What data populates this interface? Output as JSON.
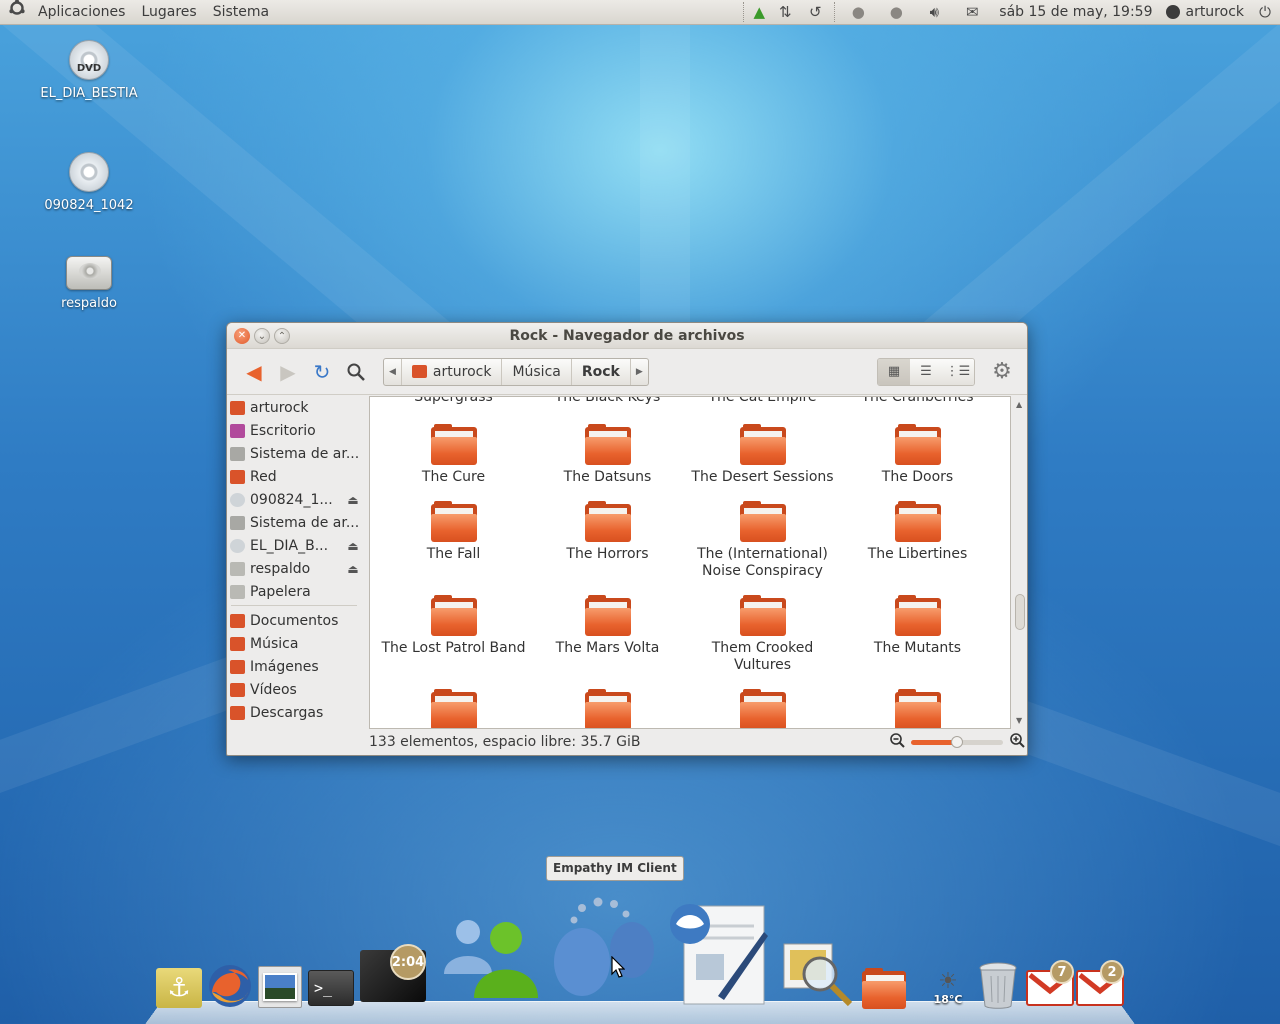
{
  "top_panel": {
    "menus": [
      "Aplicaciones",
      "Lugares",
      "Sistema"
    ],
    "clock": "sáb 15 de may, 19:59",
    "user": "arturock",
    "tray_icons": [
      "network-tree-icon",
      "transfer-icon",
      "download-icon",
      "contact-icon",
      "contact-icon",
      "volume-icon",
      "mail-icon"
    ]
  },
  "desktop": {
    "icons": [
      {
        "label": "EL_DIA_BESTIA",
        "type": "dvd-icon",
        "disc_text": "DVD"
      },
      {
        "label": "090824_1042",
        "type": "cd-icon"
      },
      {
        "label": "respaldo",
        "type": "drive-icon"
      }
    ]
  },
  "window": {
    "title": "Rock - Navegador de archivos",
    "path": [
      "arturock",
      "Música",
      "Rock"
    ],
    "sidebar": {
      "devices": [
        {
          "label": "arturock",
          "icon": "home-folder-icon",
          "color": "#d9532a"
        },
        {
          "label": "Escritorio",
          "icon": "desktop-folder-icon",
          "color": "#b14a9c"
        },
        {
          "label": "Sistema de ar...",
          "icon": "filesystem-icon",
          "color": "#a8a8a4"
        },
        {
          "label": "Red",
          "icon": "network-folder-icon",
          "color": "#d9532a"
        },
        {
          "label": "090824_1...",
          "icon": "cd-icon",
          "color": "#cfd4d8",
          "eject": true
        },
        {
          "label": "Sistema de ar...",
          "icon": "filesystem-icon",
          "color": "#a8a8a4"
        },
        {
          "label": "EL_DIA_B...",
          "icon": "dvd-icon",
          "color": "#cfd4d8",
          "eject": true
        },
        {
          "label": "respaldo",
          "icon": "drive-icon",
          "color": "#b9b9b4",
          "eject": true
        },
        {
          "label": "Papelera",
          "icon": "trash-icon",
          "color": "#b9b9b4"
        }
      ],
      "bookmarks": [
        {
          "label": "Documentos",
          "icon": "documents-folder-icon",
          "color": "#d9532a"
        },
        {
          "label": "Música",
          "icon": "music-folder-icon",
          "color": "#d9532a"
        },
        {
          "label": "Imágenes",
          "icon": "pictures-folder-icon",
          "color": "#d9532a"
        },
        {
          "label": "Vídeos",
          "icon": "videos-folder-icon",
          "color": "#d9532a"
        },
        {
          "label": "Descargas",
          "icon": "downloads-folder-icon",
          "color": "#d9532a"
        }
      ]
    },
    "partial_top_row": [
      "Supergrass",
      "The Black Keys",
      "The Cat Empire",
      "The Cranberries"
    ],
    "files": [
      "The Cure",
      "The Datsuns",
      "The Desert Sessions",
      "The Doors",
      "The Fall",
      "The Horrors",
      "The (International) Noise Conspiracy",
      "The Libertines",
      "The Lost Patrol Band",
      "The Mars Volta",
      "Them Crooked Vultures",
      "The Mutants"
    ],
    "status": "133 elementos, espacio libre: 35.7 GiB",
    "zoom_level": 0.5,
    "scroll_position": 0.72
  },
  "tooltip": "Empathy IM Client",
  "dock": {
    "items": [
      {
        "name": "anchor-icon"
      },
      {
        "name": "firefox-icon"
      },
      {
        "name": "image-viewer-icon"
      },
      {
        "name": "terminal-icon",
        "text": ">_"
      },
      {
        "name": "clock-app-icon",
        "badge": "2:04"
      },
      {
        "name": "empathy-buddies-icon"
      },
      {
        "name": "empathy-im-icon"
      },
      {
        "name": "text-editor-icon"
      },
      {
        "name": "image-search-icon"
      },
      {
        "name": "folder-icon"
      },
      {
        "name": "weather-icon",
        "text": "18°C"
      },
      {
        "name": "trash-icon"
      },
      {
        "name": "gmail-icon",
        "badge": "7"
      },
      {
        "name": "gmail-icon",
        "badge": "2"
      }
    ]
  },
  "colors": {
    "accent": "#e8622d",
    "panel": "#dcd9d3"
  }
}
